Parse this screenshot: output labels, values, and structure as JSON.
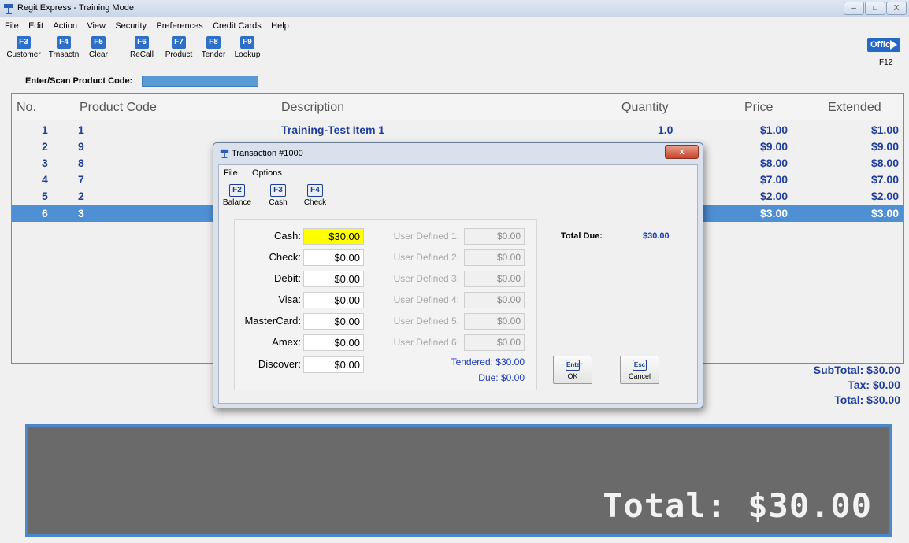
{
  "window": {
    "title": "Regit Express - Training Mode"
  },
  "menu": [
    "File",
    "Edit",
    "Action",
    "View",
    "Security",
    "Preferences",
    "Credit Cards",
    "Help"
  ],
  "toolbar": [
    {
      "key": "F3",
      "label": "Customer"
    },
    {
      "key": "F4",
      "label": "Trnsactn"
    },
    {
      "key": "F5",
      "label": "Clear"
    },
    {
      "key": "F6",
      "label": "ReCall"
    },
    {
      "key": "F7",
      "label": "Product"
    },
    {
      "key": "F8",
      "label": "Tender"
    },
    {
      "key": "F9",
      "label": "Lookup"
    }
  ],
  "office": {
    "label": "Office",
    "key": "F12"
  },
  "scan": {
    "label": "Enter/Scan Product Code:",
    "value": ""
  },
  "grid": {
    "columns": [
      "No.",
      "Product Code",
      "Description",
      "Quantity",
      "Price",
      "Extended"
    ],
    "rows": [
      {
        "no": "1",
        "code": "1",
        "description": "Training-Test Item 1",
        "quantity": "1.0",
        "price": "$1.00",
        "extended": "$1.00"
      },
      {
        "no": "2",
        "code": "9",
        "description": "",
        "quantity": "",
        "price": "$9.00",
        "extended": "$9.00"
      },
      {
        "no": "3",
        "code": "8",
        "description": "",
        "quantity": "",
        "price": "$8.00",
        "extended": "$8.00"
      },
      {
        "no": "4",
        "code": "7",
        "description": "",
        "quantity": "",
        "price": "$7.00",
        "extended": "$7.00"
      },
      {
        "no": "5",
        "code": "2",
        "description": "",
        "quantity": "",
        "price": "$2.00",
        "extended": "$2.00"
      },
      {
        "no": "6",
        "code": "3",
        "description": "",
        "quantity": "",
        "price": "$3.00",
        "extended": "$3.00"
      }
    ],
    "selected_row": 6
  },
  "totals": {
    "subtotal": "SubTotal:  $30.00",
    "tax": "Tax:  $0.00",
    "total": "Total:  $30.00"
  },
  "big_total": "Total:  $30.00",
  "dialog": {
    "title": "Transaction #1000",
    "close_label": "x",
    "menu": [
      "File",
      "Options"
    ],
    "toolbar": [
      {
        "key": "F2",
        "label": "Balance"
      },
      {
        "key": "F3",
        "label": "Cash"
      },
      {
        "key": "F4",
        "label": "Check"
      }
    ],
    "payments": [
      {
        "label": "Cash:",
        "value": "$30.00",
        "active": true
      },
      {
        "label": "Check:",
        "value": "$0.00"
      },
      {
        "label": "Debit:",
        "value": "$0.00"
      },
      {
        "label": "Visa:",
        "value": "$0.00"
      },
      {
        "label": "MasterCard:",
        "value": "$0.00"
      },
      {
        "label": "Amex:",
        "value": "$0.00"
      },
      {
        "label": "Discover:",
        "value": "$0.00"
      }
    ],
    "user_defined": [
      {
        "label": "User Defined 1:",
        "value": "$0.00"
      },
      {
        "label": "User Defined 2:",
        "value": "$0.00"
      },
      {
        "label": "User Defined 3:",
        "value": "$0.00"
      },
      {
        "label": "User Defined 4:",
        "value": "$0.00"
      },
      {
        "label": "User Defined 5:",
        "value": "$0.00"
      },
      {
        "label": "User Defined 6:",
        "value": "$0.00"
      }
    ],
    "tendered": "Tendered: $30.00",
    "due": "Due: $0.00",
    "total_due_label": "Total Due:",
    "total_due_value": "$30.00",
    "ok": {
      "key": "Enter",
      "label": "OK"
    },
    "cancel": {
      "key": "Esc",
      "label": "Cancel"
    }
  },
  "colors": {
    "accent": "#2e6fc8",
    "selected_row": "#4f8fd3",
    "grid_text": "#1f3d9a",
    "cash_highlight": "#ffff00"
  }
}
